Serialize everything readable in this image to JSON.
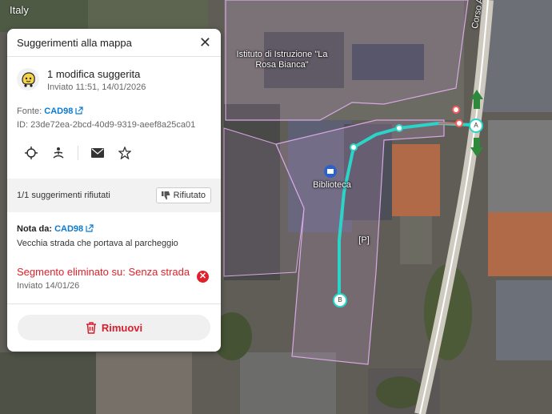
{
  "map": {
    "country": "Italy",
    "school_label": "Istituto di Istruzione \"La Rosa Bianca\"",
    "library_label": "Biblioteca",
    "parking_label": "[P]",
    "street_label": "Corso A",
    "node_a": "A",
    "node_b": "B",
    "colors": {
      "route": "#2ad4c8",
      "area": "#c99bd3"
    }
  },
  "panel": {
    "title": "Suggerimenti alla mappa",
    "summary": "1 modifica suggerita",
    "sent": "Inviato 11:51, 14/01/2026",
    "source_label": "Fonte:",
    "source_user": "CAD98",
    "id_text": "ID: 23de72ea-2bcd-40d9-9319-aeef8a25ca01",
    "rejected_text": "1/1 suggerimenti rifiutati",
    "rejected_button": "Rifiutato",
    "note_label": "Nota da:",
    "note_user": "CAD98",
    "note_text": "Vecchia strada che portava al parcheggio",
    "segment_text": "Segmento eliminato su: Senza strada",
    "segment_date": "Inviato 14/01/26",
    "remove_button": "Rimuovi",
    "icons": [
      "crosshair-icon",
      "person-meditate-icon",
      "mail-icon",
      "star-icon"
    ]
  }
}
